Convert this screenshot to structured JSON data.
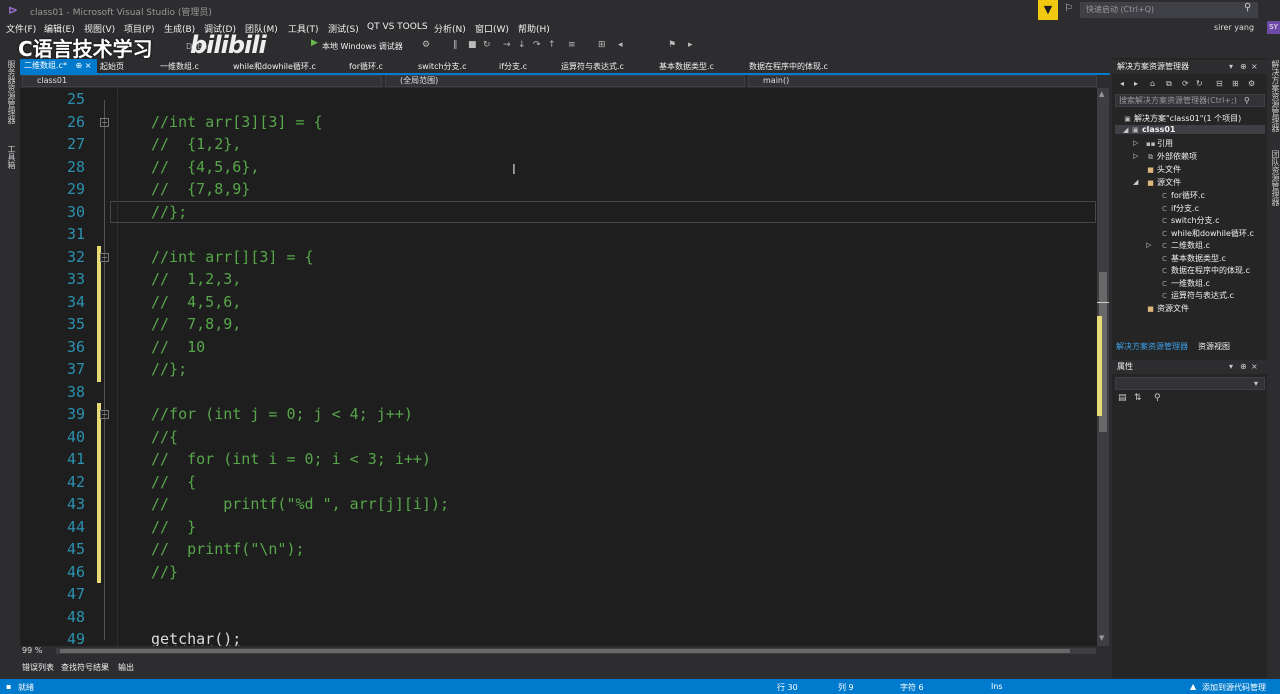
{
  "window": {
    "title": "class01 - Microsoft Visual Studio (管理员)",
    "quick_launch_placeholder": "快速启动 (Ctrl+Q)",
    "user_name": "sirer yang",
    "user_initials": "SY",
    "notify_glyph": "▼"
  },
  "menu": [
    "文件(F)",
    "编辑(E)",
    "视图(V)",
    "项目(P)",
    "生成(B)",
    "调试(D)",
    "团队(M)",
    "工具(T)",
    "测试(S)",
    "QT VS TOOLS",
    "分析(N)",
    "窗口(W)",
    "帮助(H)"
  ],
  "watermark": {
    "text": "C语言技术学习",
    "brand": "bilibili"
  },
  "toolbar": {
    "config": "Debug",
    "run_label": "本地 Windows 调试器",
    "run_glyph": "▶"
  },
  "left_strip": [
    "服务器资源管理器",
    "工具箱"
  ],
  "right_strip": [
    "解决方案资源管理器",
    "团队资源管理器"
  ],
  "doc_tabs": {
    "active": "二维数组.c*",
    "active_glyphs": "⊕ ×",
    "others": [
      "起始页",
      "一维数组.c",
      "while和dowhile循环.c",
      "for循环.c",
      "switch分支.c",
      "if分支.c",
      "运算符与表达式.c",
      "基本数据类型.c",
      "数据在程序中的体现.c"
    ]
  },
  "nav": {
    "project": "class01",
    "scope": "(全局范围)",
    "member": "main()"
  },
  "editor": {
    "lines": [
      {
        "num": "25",
        "text": ""
      },
      {
        "num": "26",
        "text": "//int arr[3][3] = {"
      },
      {
        "num": "27",
        "text": "//  {1,2},"
      },
      {
        "num": "28",
        "text": "//  {4,5,6},"
      },
      {
        "num": "29",
        "text": "//  {7,8,9}"
      },
      {
        "num": "30",
        "text": "//};"
      },
      {
        "num": "31",
        "text": ""
      },
      {
        "num": "32",
        "text": "//int arr[][3] = {"
      },
      {
        "num": "33",
        "text": "//  1,2,3,"
      },
      {
        "num": "34",
        "text": "//  4,5,6,"
      },
      {
        "num": "35",
        "text": "//  7,8,9,"
      },
      {
        "num": "36",
        "text": "//  10"
      },
      {
        "num": "37",
        "text": "//};"
      },
      {
        "num": "38",
        "text": ""
      },
      {
        "num": "39",
        "text": "//for (int j = 0; j < 4; j++)"
      },
      {
        "num": "40",
        "text": "//{"
      },
      {
        "num": "41",
        "text": "//  for (int i = 0; i < 3; i++)"
      },
      {
        "num": "42",
        "text": "//  {"
      },
      {
        "num": "43",
        "text": "//      printf(\"%d \", arr[j][i]);"
      },
      {
        "num": "44",
        "text": "//  }"
      },
      {
        "num": "45",
        "text": "//  printf(\"\\n\");"
      },
      {
        "num": "46",
        "text": "//}"
      },
      {
        "num": "47",
        "text": ""
      },
      {
        "num": "48",
        "text": ""
      },
      {
        "num": "49",
        "text": "getchar();"
      }
    ],
    "zoom": "99 %"
  },
  "output_tabs": [
    "错误列表",
    "查找符号结果",
    "输出"
  ],
  "status": {
    "ready": "就绪",
    "line": "行 30",
    "col": "列 9",
    "char": "字符 6",
    "mode": "Ins",
    "source_control": "添加到源代码管理"
  },
  "solution_explorer": {
    "title": "解决方案资源管理器",
    "search_placeholder": "搜索解决方案资源管理器(Ctrl+;)",
    "solution": "解决方案\"class01\"(1 个项目)",
    "project": "class01",
    "nodes": [
      "引用",
      "外部依赖项",
      "头文件",
      "源文件"
    ],
    "files": [
      "for循环.c",
      "if分支.c",
      "switch分支.c",
      "while和dowhile循环.c",
      "二维数组.c",
      "基本数据类型.c",
      "数据在程序中的体现.c",
      "一维数组.c",
      "运算符与表达式.c"
    ],
    "resources": "资源文件",
    "tab_active": "解决方案资源管理器",
    "tab_other": "资源视图"
  },
  "properties": {
    "title": "属性"
  }
}
